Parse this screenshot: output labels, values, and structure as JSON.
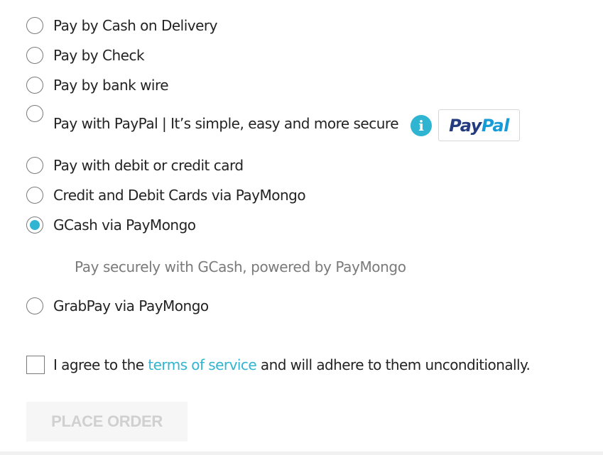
{
  "payment_options": [
    {
      "label": "Pay by Cash on Delivery",
      "checked": false
    },
    {
      "label": "Pay by Check",
      "checked": false
    },
    {
      "label": "Pay by bank wire",
      "checked": false
    },
    {
      "label": "Pay with PayPal | It’s simple, easy and more secure",
      "checked": false,
      "info_icon": "info-icon",
      "logo_text_1": "Pay",
      "logo_text_2": "Pal"
    },
    {
      "label": "Pay with debit or credit card",
      "checked": false
    },
    {
      "label": "Credit and Debit Cards via PayMongo",
      "checked": false
    },
    {
      "label": "GCash via PayMongo",
      "checked": true,
      "description": "Pay securely with GCash, powered by PayMongo"
    },
    {
      "label": "GrabPay via PayMongo",
      "checked": false
    }
  ],
  "terms": {
    "checked": false,
    "before": "I agree to the ",
    "link": "terms of service",
    "after": " and will adhere to them unconditionally."
  },
  "place_order": {
    "label": "PLACE ORDER",
    "disabled": true
  },
  "colors": {
    "accent": "#2fb5d2",
    "text": "#232323",
    "muted": "#7a7a7a",
    "paypal_dark": "#253b80",
    "paypal_light": "#179bd7"
  }
}
